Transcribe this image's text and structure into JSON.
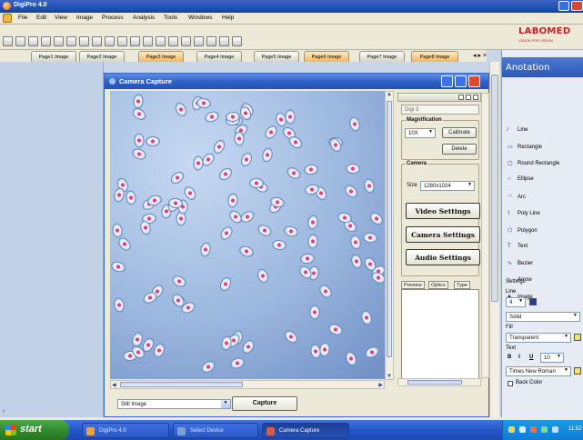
{
  "app": {
    "title": "DigiPro 4.0"
  },
  "menu": [
    "File",
    "Edit",
    "View",
    "Image",
    "Process",
    "Analysis",
    "Tools",
    "Windows",
    "Help"
  ],
  "logo": {
    "brand": "LABOMED",
    "tagline": "VISION FOR VISION"
  },
  "page_tabs": [
    "Page1 Image",
    "Page2 Image",
    "Page3 Image",
    "Page4 Image",
    "Page5 Image",
    "Page6 Image",
    "Page7 Image",
    "Page8 Image"
  ],
  "tab_nav": "◂ ▸ ×",
  "camera_window": {
    "title": "Camera Capture",
    "camera_name": "Digi 3",
    "magnification_label": "Magnification",
    "magnification_value": "10X",
    "calibrate_label": "Calibrate",
    "delete_label": "Delete",
    "camera_group_label": "Camera",
    "size_label": "Size",
    "size_value": "1280x1024",
    "video_settings_label": "Video Settings",
    "camera_settings_label": "Camera Settings",
    "audio_settings_label": "Audio Settings",
    "subtabs": [
      "Preview",
      "Optics",
      "Type"
    ],
    "mode_value": "Still Image",
    "capture_label": "Capture"
  },
  "annotation": {
    "title": "Anotation",
    "tools": [
      {
        "icon": "line-icon",
        "glyph": "⁄",
        "label": "Line"
      },
      {
        "icon": "rectangle-icon",
        "glyph": "▭",
        "label": "Rectangle"
      },
      {
        "icon": "round-rectangle-icon",
        "glyph": "▢",
        "label": "Round Rectangle"
      },
      {
        "icon": "ellipse-icon",
        "glyph": "○",
        "label": "Ellipse"
      },
      {
        "icon": "arc-icon",
        "glyph": "◠",
        "label": "Arc"
      },
      {
        "icon": "polyline-icon",
        "glyph": "⌇",
        "label": "Poly Line"
      },
      {
        "icon": "polygon-icon",
        "glyph": "⬡",
        "label": "Polygon"
      },
      {
        "icon": "text-icon",
        "glyph": "T",
        "label": "Text"
      },
      {
        "icon": "bezier-icon",
        "glyph": "∿",
        "label": "Bezier"
      },
      {
        "icon": "arrow-icon",
        "glyph": "↑",
        "label": "Arrow"
      },
      {
        "icon": "image-icon",
        "glyph": "♣",
        "label": "Image"
      }
    ],
    "settings": {
      "title": "Settings",
      "line_label": "Line",
      "line_width": "4",
      "line_style": "Solid",
      "line_color": "#1f3f96",
      "fill_label": "Fill",
      "fill_value": "Transparent",
      "fill_color": "#f0e26a",
      "text_label": "Text",
      "bold": "B",
      "italic": "I",
      "underline": "U",
      "font_size": "10",
      "font_name": "Times New Roman",
      "back_color_label": "Back Color"
    }
  },
  "taskbar": {
    "start_label": "start",
    "tasks": [
      "DigiPro 4.0",
      "Select Device",
      "Camera Capture"
    ],
    "clock": "11:52"
  },
  "colors": {
    "title_bar": "#2450b5",
    "accent_red": "#c81e1e",
    "panel_bg": "#ece9d8",
    "start_green": "#2f8a2b"
  }
}
